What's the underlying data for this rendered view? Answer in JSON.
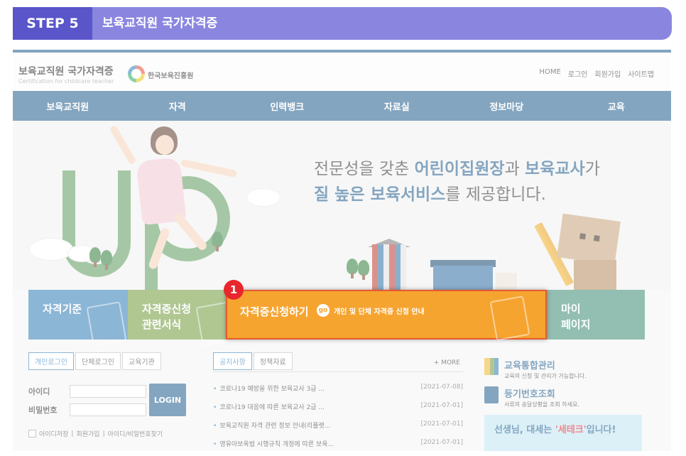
{
  "step": {
    "label": "STEP 5",
    "title": "보육교직원 국가자격증"
  },
  "site": {
    "logo_title": "보육교직원 국가자격증",
    "logo_subtitle": "Certification for childcare teacher",
    "org_name": "한국보육진흥원",
    "util_links": [
      "HOME",
      "로그인",
      "회원가입",
      "사이트맵"
    ],
    "nav": [
      "보육교직원",
      "자격",
      "인력뱅크",
      "자료실",
      "정보마당",
      "교육"
    ]
  },
  "hero": {
    "line1_prefix": "전문성을 갖춘 ",
    "line1_hl1": "어린이집원장",
    "line1_mid": "과 ",
    "line1_hl2": "보육교사",
    "line1_suffix": "가",
    "line2_hl": "질 높은 보육서비스",
    "line2_suffix": "를 제공합니다."
  },
  "tiles": {
    "standard": "자격기준",
    "forms_line1": "자격증신청",
    "forms_line2": "관련서식",
    "apply_label": "자격증신청하기",
    "apply_go": "go",
    "apply_desc": "개인 및 단체 자격증 신청 안내",
    "mypage_line1": "마이",
    "mypage_line2": "페이지"
  },
  "marker": "1",
  "login": {
    "tabs": [
      "개인로그인",
      "단체로그인",
      "교육기관"
    ],
    "id_label": "아이디",
    "pw_label": "비밀번호",
    "button": "LOGIN",
    "save_id": "아이디저장",
    "signup": "회원가입",
    "find": "아이디/비밀번호찾기"
  },
  "notice": {
    "tabs": [
      "공지사항",
      "정책자료"
    ],
    "more": "+ MORE",
    "items": [
      {
        "title": "코로나19 예방을 위한 보육교사 3급 ...",
        "date": "[2021-07-08]"
      },
      {
        "title": "코로나19 대응에 따른 보육교사 2급 ...",
        "date": "[2021-07-01]"
      },
      {
        "title": "보육교직원 자격 관련 정보 안내(리플렛...",
        "date": "[2021-07-01]"
      },
      {
        "title": "영유아보육법 시행규칙 개정에 따른 보육...",
        "date": "[2021-07-01]"
      }
    ]
  },
  "side": {
    "edu_title": "교육통합관리",
    "edu_sub": "교육의 신청 및 관리가 가능합니다.",
    "reg_title": "등기번호조회",
    "reg_sub": "서류의 송달상황을 조회 하세요.",
    "banner_prefix": "선생님, 대세는 ",
    "banner_hl": "'세테크'",
    "banner_suffix": "입니다!"
  },
  "colors": {
    "nav": "#1f5c8c",
    "step_box": "#5a55c9",
    "step_bar": "#8a86e0",
    "apply_tile": "#f6a430",
    "marker": "#e8262d"
  }
}
